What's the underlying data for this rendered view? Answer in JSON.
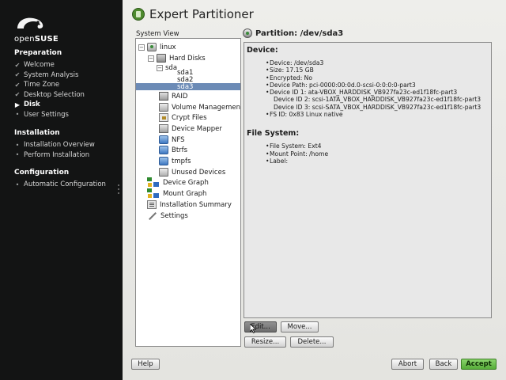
{
  "sidebar": {
    "logo_text_open": "open",
    "logo_text_suse": "SUSE",
    "sections": [
      {
        "title": "Preparation",
        "steps": [
          {
            "label": "Welcome",
            "state": "done"
          },
          {
            "label": "System Analysis",
            "state": "done"
          },
          {
            "label": "Time Zone",
            "state": "done"
          },
          {
            "label": "Desktop Selection",
            "state": "done"
          },
          {
            "label": "Disk",
            "state": "current"
          },
          {
            "label": "User Settings",
            "state": "pending"
          }
        ]
      },
      {
        "title": "Installation",
        "steps": [
          {
            "label": "Installation Overview",
            "state": "pending"
          },
          {
            "label": "Perform Installation",
            "state": "pending"
          }
        ]
      },
      {
        "title": "Configuration",
        "steps": [
          {
            "label": "Automatic Configuration",
            "state": "pending"
          }
        ]
      }
    ]
  },
  "main": {
    "title": "Expert Partitioner",
    "system_view_label": "System View",
    "tree": [
      {
        "label": "linux",
        "expander": "−",
        "icon": "computer-icon"
      },
      {
        "label": "Hard Disks",
        "expander": "−",
        "icon": "hard-disks-icon"
      },
      {
        "label": "sda",
        "expander": "−",
        "icon": ""
      },
      {
        "label": "sda1",
        "expander": "",
        "icon": ""
      },
      {
        "label": "sda2",
        "expander": "",
        "icon": ""
      },
      {
        "label": "sda3",
        "expander": "",
        "icon": "",
        "selected": true
      },
      {
        "label": "RAID",
        "expander": "",
        "icon": "raid-icon"
      },
      {
        "label": "Volume Management",
        "expander": "",
        "icon": "volume-management-icon"
      },
      {
        "label": "Crypt Files",
        "expander": "",
        "icon": "crypt-files-icon"
      },
      {
        "label": "Device Mapper",
        "expander": "",
        "icon": "device-mapper-icon"
      },
      {
        "label": "NFS",
        "expander": "",
        "icon": "nfs-icon"
      },
      {
        "label": "Btrfs",
        "expander": "",
        "icon": "btrfs-icon"
      },
      {
        "label": "tmpfs",
        "expander": "",
        "icon": "tmpfs-icon"
      },
      {
        "label": "Unused Devices",
        "expander": "",
        "icon": "unused-devices-icon"
      },
      {
        "label": "Device Graph",
        "expander": "",
        "icon": "device-graph-icon"
      },
      {
        "label": "Mount Graph",
        "expander": "",
        "icon": "mount-graph-icon"
      },
      {
        "label": "Installation Summary",
        "expander": "",
        "icon": "installation-summary-icon"
      },
      {
        "label": "Settings",
        "expander": "",
        "icon": "settings-icon"
      }
    ],
    "partition_title": "Partition: /dev/sda3",
    "device_heading": "Device:",
    "device_lines": [
      {
        "text": "Device: /dev/sda3",
        "indent": false
      },
      {
        "text": "Size: 17.15 GB",
        "indent": false
      },
      {
        "text": "Encrypted: No",
        "indent": false
      },
      {
        "text": "Device Path: pci-0000:00:0d.0-scsi-0:0:0:0-part3",
        "indent": false
      },
      {
        "text": "Device ID 1: ata-VBOX_HARDDISK_VB927fa23c-ed1f18fc-part3",
        "indent": false
      },
      {
        "text": "Device ID 2: scsi-1ATA_VBOX_HARDDISK_VB927fa23c-ed1f18fc-part3",
        "indent": true
      },
      {
        "text": "Device ID 3: scsi-SATA_VBOX_HARDDISK_VB927fa23c-ed1f18fc-part3",
        "indent": true
      },
      {
        "text": "FS ID: 0x83 Linux native",
        "indent": false
      }
    ],
    "fs_heading": "File System:",
    "fs_lines": [
      {
        "text": "File System: Ext4"
      },
      {
        "text": "Mount Point: /home"
      },
      {
        "text": "Label:"
      }
    ],
    "buttons": {
      "edit": "Edit...",
      "move": "Move...",
      "resize": "Resize...",
      "delete": "Delete..."
    }
  },
  "footer": {
    "help": "Help",
    "abort": "Abort",
    "back": "Back",
    "accept": "Accept"
  },
  "colors": {
    "sidebar_bg": "#131414",
    "selection": "#6c8bb6",
    "accept": "#57ad3a"
  }
}
